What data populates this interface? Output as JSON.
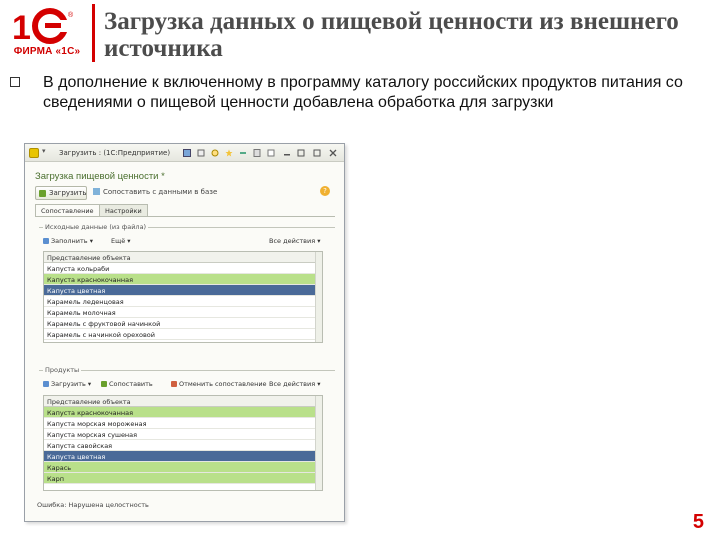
{
  "slide": {
    "logo_text": "ФИРМА «1С»",
    "title": "Загрузка данных о пищевой ценности из внешнего источника",
    "bullet": "В дополнение к включенному в программу каталогу российских продуктов питания со сведениями о пищевой ценности добавлена обработка для загрузки",
    "page_number": "5",
    "accent_color": "#d40000"
  },
  "window": {
    "tab_title": "Загрузить : (1С:Предприятие)",
    "form_title": "Загрузка пищевой ценности *",
    "load_button": "Загрузить",
    "match_button": "Сопоставить с данными в базе",
    "tabs": [
      "Сопоставление",
      "Настройки"
    ],
    "top_group": {
      "caption": "Исходные данные (из файла)",
      "fill_label": "Заполнить",
      "more_label": "Ещё",
      "actions_label": "Все действия",
      "column_header": "Представление объекта",
      "rows": [
        {
          "text": "Капуста кольраби",
          "style": "white"
        },
        {
          "text": "Капуста краснокочанная",
          "style": "green"
        },
        {
          "text": "Капуста цветная",
          "style": "blue"
        },
        {
          "text": "Карамель леденцовая",
          "style": "white"
        },
        {
          "text": "Карамель молочная",
          "style": "white"
        },
        {
          "text": "Карамель с фруктовой начинкой",
          "style": "white"
        },
        {
          "text": "Карамель с начинкой ореховой",
          "style": "white"
        }
      ]
    },
    "bottom_group": {
      "caption": "Продукты",
      "load_label": "Загрузить",
      "match_label": "Сопоставить",
      "cancel_match_label": "Отменить сопоставление",
      "actions_label": "Все действия",
      "column_header": "Представление объекта",
      "rows": [
        {
          "text": "Капуста краснокочанная",
          "style": "green"
        },
        {
          "text": "Капуста морская мороженая",
          "style": "white"
        },
        {
          "text": "Капуста морская сушеная",
          "style": "white"
        },
        {
          "text": "Капуста савойская",
          "style": "white"
        },
        {
          "text": "Капуста цветная",
          "style": "blue"
        },
        {
          "text": "Карась",
          "style": "green"
        },
        {
          "text": "Карп",
          "style": "green"
        }
      ]
    },
    "status_text": "Ошибка: Нарушена целостность"
  }
}
